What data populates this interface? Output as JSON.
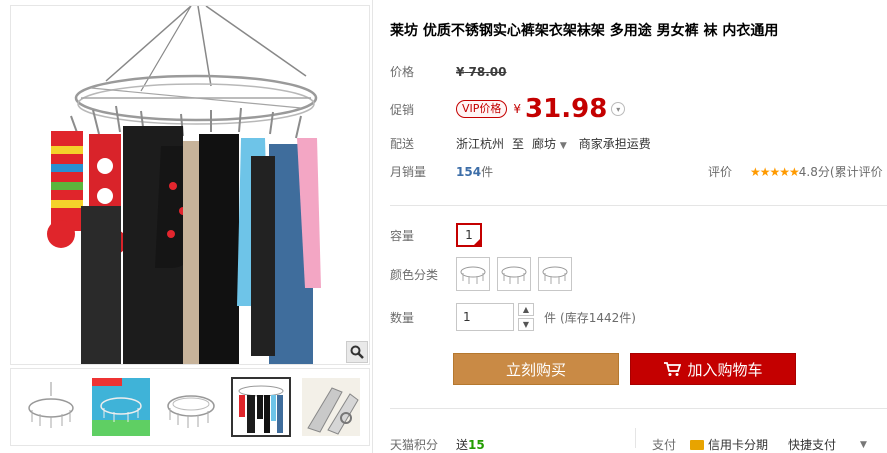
{
  "product": {
    "title": "莱坊 优质不锈钢实心裤架衣架袜架 多用途 男女裤 袜 内衣通用"
  },
  "price": {
    "label": "价格",
    "currency": "¥",
    "original": "78.00"
  },
  "promo": {
    "label": "促销",
    "badge": "VIP价格",
    "currency": "¥",
    "value": "31.98"
  },
  "delivery": {
    "label": "配送",
    "from": "浙江杭州",
    "to_word": "至",
    "to": "廊坊",
    "shipping": "商家承担运费"
  },
  "sales": {
    "label": "月销量",
    "count": "154",
    "unit": "件",
    "rating_label": "评价",
    "stars": "★★★★★",
    "rating_text": "4.8分(累计评价"
  },
  "capacity": {
    "label": "容量",
    "selected": "1"
  },
  "color": {
    "label": "颜色分类",
    "options": [
      "round-hanger-20-clips",
      "round-hanger-30-clips",
      "round-hanger-40-clips"
    ]
  },
  "quantity": {
    "label": "数量",
    "value": "1",
    "unit": "件",
    "stock": "(库存1442件)"
  },
  "actions": {
    "buy_now": "立刻购买",
    "add_to_cart": "加入购物车"
  },
  "footer": {
    "points_label": "天猫积分",
    "points_prefix": "送",
    "points_value": "15",
    "pay_label": "支付",
    "credit": "信用卡分期",
    "quick_pay": "快捷支付"
  },
  "colors": {
    "accent_red": "#c40000",
    "buy_button": "#c98a45",
    "link_blue": "#3d6ea8",
    "green": "#229c00"
  },
  "thumbnails": [
    "hanger-round-front",
    "hanger-on-blue-background",
    "hanger-side-view",
    "hanger-with-socks",
    "hanger-clip-closeup"
  ]
}
